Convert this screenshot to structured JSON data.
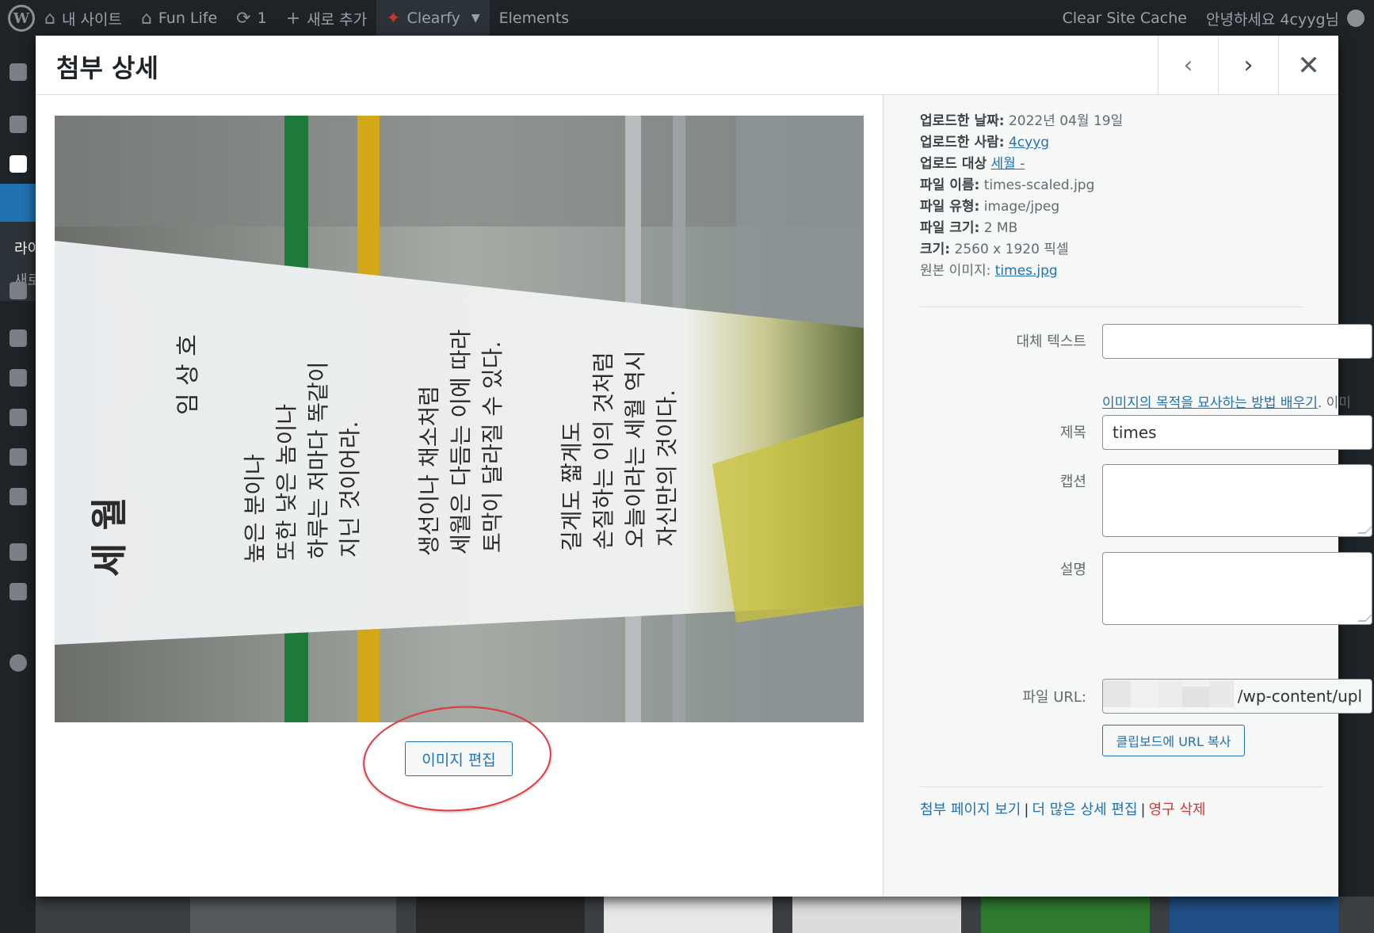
{
  "admin_bar": {
    "site_label": "내 사이트",
    "fun_life": "Fun Life",
    "updates_count": "1",
    "new_label": "새로 추가",
    "clearfy": "Clearfy",
    "elements": "Elements",
    "clear_cache": "Clear Site Cache",
    "greeting": "안녕하세요 4cyyg님"
  },
  "sidebar": {
    "partial_1": "라이",
    "partial_2": "새로"
  },
  "modal": {
    "title": "첨부 상세",
    "prev_icon": "‹",
    "next_icon": "›",
    "close_icon": "✕"
  },
  "image": {
    "title_vertical": "세 월",
    "author_vertical": "임 상 호",
    "lines": [
      "높은 분이나",
      "또한 낮은 놈이나",
      "하루는 저마다 똑같이",
      "지닌 것이어라.",
      "생선이나 채소처럼",
      "세월은 다듬는 이에 따라",
      "토막이 달라질 수 있다.",
      "길게도 짧게도",
      "손질하는 이의 것처럼",
      "오늘이라는 세월 역시",
      "자신만의 것이다."
    ]
  },
  "edit_button": "이미지 편집",
  "details": {
    "upload_date_label": "업로드한 날짜:",
    "upload_date_value": "2022년 04월 19일",
    "uploaded_by_label": "업로드한 사람:",
    "uploaded_by_value": "4cyyg",
    "uploaded_to_label": "업로드 대상",
    "uploaded_to_value": "세월 -",
    "file_name_label": "파일 이름:",
    "file_name_value": "times-scaled.jpg",
    "file_type_label": "파일 유형:",
    "file_type_value": "image/jpeg",
    "file_size_label": "파일 크기:",
    "file_size_value": "2 MB",
    "dimensions_label": "크기:",
    "dimensions_value": "2560 x 1920 픽셀",
    "original_label": "원본 이미지:",
    "original_value": "times.jpg"
  },
  "form": {
    "alt_label": "대체 텍스트",
    "alt_value": "",
    "alt_help_link": "이미지의 목적을 묘사하는 방법 배우기",
    "alt_help_text": ". 이미지가 순전히 장식이라면 비워두세요.",
    "title_label": "제목",
    "title_value": "times",
    "caption_label": "캡션",
    "caption_value": "",
    "description_label": "설명",
    "description_value": "",
    "url_label": "파일 URL:",
    "url_value": "/wp-content/upl",
    "copy_button": "클립보드에 URL 복사"
  },
  "actions": {
    "view": "첨부 페이지 보기",
    "edit_more": "더 많은 상세 편집",
    "delete": "영구 삭제",
    "separator": "|"
  },
  "colors": {
    "accent": "#2271b1",
    "danger": "#d63638",
    "admin_bar": "#1d2327",
    "highlight_oval": "#e03a3e"
  }
}
